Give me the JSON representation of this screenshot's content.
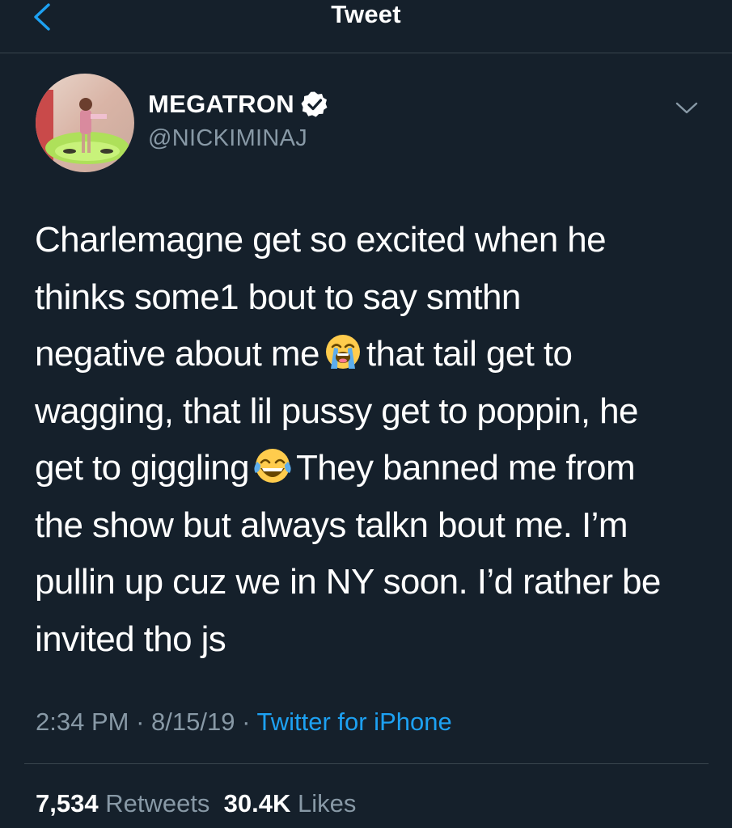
{
  "header": {
    "title": "Tweet",
    "back_icon": "chevron-left-icon"
  },
  "tweet": {
    "author": {
      "name": "MEGATRON",
      "handle": "@NICKIMINAJ",
      "verified": true
    },
    "text_parts": [
      "Charlemagne get so excited when he\nthinks some1 bout to say smthn\nnegative about me",
      "that tail get to\nwagging, that lil pussy get to poppin, he\nget to giggling",
      "They banned me from\nthe show but always talkn bout me. I’m\npullin up cuz we in NY soon. I’d rather be\ninvited tho js"
    ],
    "emojis": [
      "loudly-crying-face-emoji",
      "face-with-tears-of-joy-emoji"
    ],
    "time": "2:34 PM",
    "date": "8/15/19",
    "separator": "·",
    "source": "Twitter for iPhone"
  },
  "stats": {
    "retweets_count": "7,534",
    "retweets_label": "Retweets",
    "likes_count": "30.4K",
    "likes_label": "Likes"
  },
  "colors": {
    "background": "#15202b",
    "secondary_text": "#8899a6",
    "accent": "#1da1f2",
    "divider": "#38444d",
    "verified_badge": "#ffffff"
  }
}
